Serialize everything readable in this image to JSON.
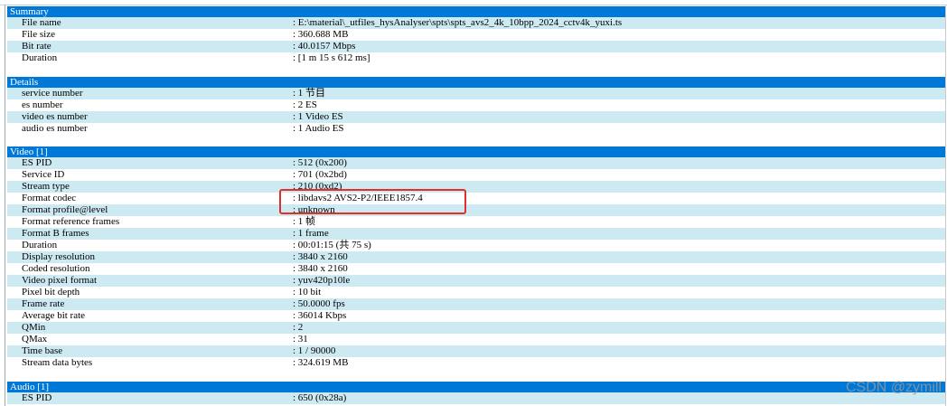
{
  "sections": {
    "summary": {
      "title": "Summary",
      "rows": [
        {
          "key": "File name",
          "value": ": E:\\material\\_utfiles_hysAnalyser\\spts\\spts_avs2_4k_10bpp_2024_cctv4k_yuxi.ts"
        },
        {
          "key": "File size",
          "value": ": 360.688 MB"
        },
        {
          "key": "Bit rate",
          "value": ": 40.0157 Mbps"
        },
        {
          "key": "Duration",
          "value": ": [1 m 15 s 612 ms]"
        }
      ]
    },
    "details": {
      "title": "Details",
      "rows": [
        {
          "key": "service number",
          "value": ": 1 节目"
        },
        {
          "key": "es number",
          "value": ": 2 ES"
        },
        {
          "key": "video es number",
          "value": ": 1 Video ES"
        },
        {
          "key": "audio es number",
          "value": ": 1 Audio ES"
        }
      ]
    },
    "video": {
      "title": "Video [1]",
      "rows": [
        {
          "key": "ES PID",
          "value": ": 512 (0x200)"
        },
        {
          "key": "Service ID",
          "value": ": 701 (0x2bd)"
        },
        {
          "key": "Stream type",
          "value": ": 210 (0xd2)"
        },
        {
          "key": "Format codec",
          "value": ": libdavs2 AVS2-P2/IEEE1857.4"
        },
        {
          "key": "Format profile@level",
          "value": ": unknown"
        },
        {
          "key": "Format reference frames",
          "value": ": 1 帧"
        },
        {
          "key": "Format B frames",
          "value": ": 1 frame"
        },
        {
          "key": "Duration",
          "value": ": 00:01:15 (共 75 s)"
        },
        {
          "key": "Display resolution",
          "value": ": 3840 x 2160"
        },
        {
          "key": "Coded resolution",
          "value": ": 3840 x 2160"
        },
        {
          "key": "Video pixel format",
          "value": ": yuv420p10le"
        },
        {
          "key": "Pixel bit depth",
          "value": ": 10 bit"
        },
        {
          "key": "Frame rate",
          "value": ": 50.0000 fps"
        },
        {
          "key": "Average bit rate",
          "value": ": 36014 Kbps"
        },
        {
          "key": "QMin",
          "value": ": 2"
        },
        {
          "key": "QMax",
          "value": ": 31"
        },
        {
          "key": "Time base",
          "value": ": 1 / 90000"
        },
        {
          "key": "Stream data bytes",
          "value": ": 324.619 MB"
        }
      ]
    },
    "audio": {
      "title": "Audio [1]",
      "rows": [
        {
          "key": "ES PID",
          "value": ": 650 (0x28a)"
        }
      ]
    }
  },
  "watermark": "CSDN @zymill",
  "colors": {
    "header_bg": "#0078d7",
    "alt_row_bg": "#cdeaf2",
    "highlight_border": "#e0302a"
  }
}
